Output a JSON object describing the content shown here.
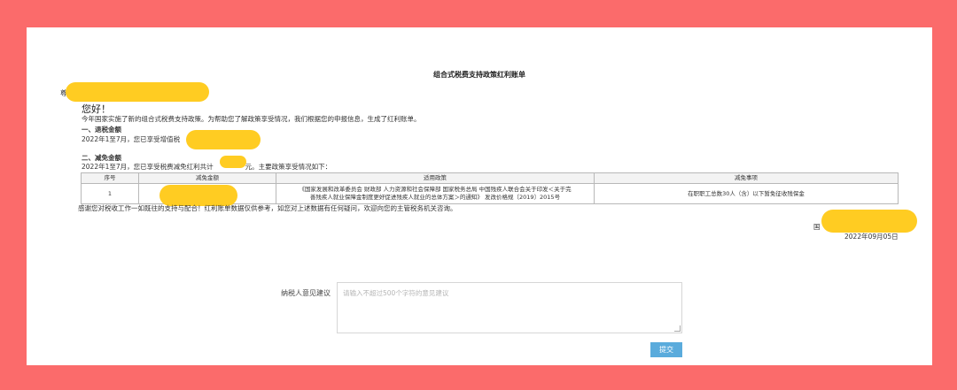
{
  "page": {
    "title": "组合式税费支持政策红利账单",
    "leading_char": "尊",
    "greeting": "您好！",
    "intro": "今年国家实施了新的组合式税费支持政策。为帮助您了解政策享受情况，我们根据您的申报信息，生成了红利账单。",
    "section1_heading": "一、退税金额",
    "section1_text": "2022年1至7月，您已享受增值税",
    "section2_heading": "二、减免金额",
    "section2_text_a": "2022年1至7月，您已享受税费减免红利共计",
    "section2_text_b": "元。主要政策享受情况如下：",
    "closing": "感谢您对税收工作一如既往的支持与配合！红利账单数据仅供参考，如您对上述数据有任何疑问，欢迎向您的主管税务机关咨询。",
    "signature_prefix": "国",
    "date": "2022年09月05日"
  },
  "relief_table": {
    "headers": [
      "序号",
      "减免金额",
      "适用政策",
      "减免事项"
    ],
    "rows": [
      {
        "index": "1",
        "amount": "",
        "policy_line1": "《国家发展和改革委员会 财政部 人力资源和社会保障部 国家税务总局 中国残疾人联合会关于印发＜关于完",
        "policy_line2": "善残疾人就业保障金制度更好促进残疾人就业的总体方案＞的通知》 发改价格规〔2019〕2015号",
        "item": "在职职工总数30人（含）以下暂免征收残保金"
      }
    ]
  },
  "feedback": {
    "label": "纳税人意见建议",
    "placeholder": "请输入不超过500个字符的意见建议",
    "submit_label": "提交"
  },
  "colors": {
    "background": "#fb6b6b",
    "panel": "#ffffff",
    "redaction": "#ffcc22",
    "submit_button": "#5aabdc"
  }
}
